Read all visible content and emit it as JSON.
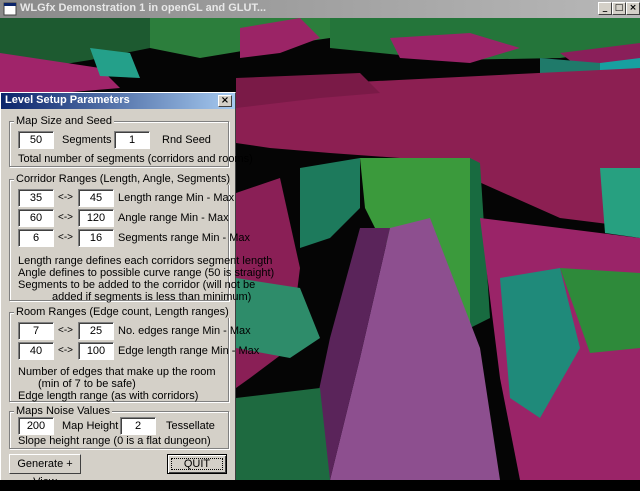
{
  "window": {
    "title": "WLGfx Demonstration 1 in openGL and GLUT...",
    "minimize_glyph": "_",
    "maximize_glyph": "□",
    "close_glyph": "×"
  },
  "dialog": {
    "title": "Level Setup Parameters",
    "close_glyph": "×",
    "map_group": {
      "label": "Map Size and Seed",
      "segments_value": "50",
      "segments_label": "Segments",
      "seed_value": "1",
      "seed_label": "Rnd Seed",
      "note": "Total number of segments (corridors and rooms)"
    },
    "corridor_group": {
      "label": "Corridor Ranges (Length, Angle, Segments)",
      "arrow": "<->",
      "rows": [
        {
          "min": "35",
          "max": "45",
          "label": "Length range Min - Max"
        },
        {
          "min": "60",
          "max": "120",
          "label": "Angle range Min - Max"
        },
        {
          "min": "6",
          "max": "16",
          "label": "Segments range Min - Max"
        }
      ],
      "notes": [
        "Length range defines each corridors segment length",
        "Angle defines to possible curve range (50 is straight)",
        "Segments to be added to the corridor (will not be",
        "added if segments is less than minimum)"
      ]
    },
    "room_group": {
      "label": "Room Ranges (Edge count, Length ranges)",
      "arrow": "<->",
      "rows": [
        {
          "min": "7",
          "max": "25",
          "label": "No. edges range Min - Max"
        },
        {
          "min": "40",
          "max": "100",
          "label": "Edge length range Min - Max"
        }
      ],
      "notes": [
        "Number of edges that make up the room",
        "(min of 7 to be safe)",
        "Edge length range (as with corridors)"
      ]
    },
    "noise_group": {
      "label": "Maps Noise Values",
      "height_value": "200",
      "height_label": "Map Height",
      "tess_value": "2",
      "tess_label": "Tessellate",
      "note": "Slope height range (0 is a flat dungeon)"
    },
    "generate_button": "Generate + View",
    "quit_button": "QUIT"
  },
  "colors": {
    "magenta_floor": "#8c1f52",
    "green_wall": "#2e8a3a",
    "teal_wall": "#1f6d62",
    "path": "#8d4f8f",
    "dialog_face": "#d4d0c8",
    "title_active": "#0a246a"
  }
}
